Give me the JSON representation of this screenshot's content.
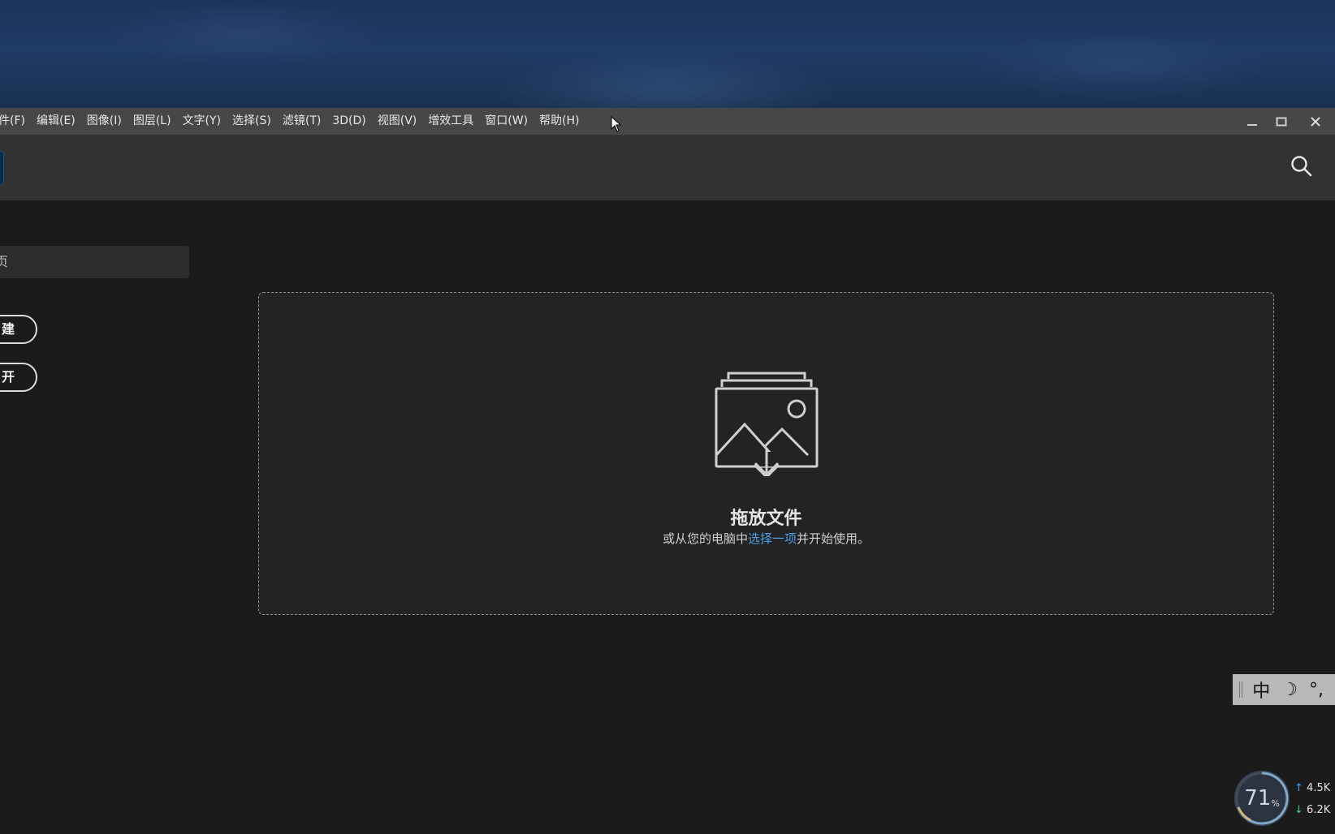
{
  "menubar": {
    "items": [
      "件(F)",
      "编辑(E)",
      "图像(I)",
      "图层(L)",
      "文字(Y)",
      "选择(S)",
      "滤镜(T)",
      "3D(D)",
      "视图(V)",
      "增效工具",
      "窗口(W)",
      "帮助(H)"
    ]
  },
  "window_controls": {
    "minimize": "—",
    "maximize": "☐",
    "close": "✕"
  },
  "sidebar": {
    "search_text": "页",
    "new_label": "建",
    "open_label": "开"
  },
  "dropzone": {
    "title": "拖放文件",
    "sub_prefix": "或从您的电脑中",
    "sub_link": "选择一项",
    "sub_suffix": "并开始使用。"
  },
  "ime": {
    "lang": "中",
    "mode": "☽",
    "punct": "°,"
  },
  "widget": {
    "cpu_percent": "71",
    "percent_sign": "%",
    "upload": "4.5K",
    "download": "6.2K"
  },
  "colors": {
    "accent_link": "#4d9de8",
    "menubar": "#474747",
    "toolbar": "#323232",
    "background": "#1b1b1b"
  }
}
